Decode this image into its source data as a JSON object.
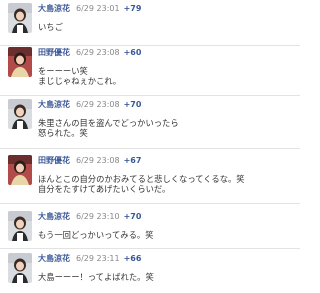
{
  "colors": {
    "name": "#3b5998",
    "time": "#888888",
    "text": "#333333",
    "divider": "#e3e3e3"
  },
  "posts": [
    {
      "author": "大島涼花",
      "time": "6/29 23:01",
      "score": "+79",
      "lines": [
        "いちご"
      ],
      "avatar": "user-a-avatar"
    },
    {
      "author": "田野優花",
      "time": "6/29 23:08",
      "score": "+60",
      "lines": [
        "をーーーい笑",
        "まじじゃねぇかこれ。"
      ],
      "avatar": "user-b-avatar"
    },
    {
      "author": "大島涼花",
      "time": "6/29 23:08",
      "score": "+70",
      "lines": [
        "朱里さんの目を盗んでどっかいったら",
        "怒られた。笑"
      ],
      "avatar": "user-a-avatar"
    },
    {
      "author": "田野優花",
      "time": "6/29 23:08",
      "score": "+67",
      "lines": [
        "ほんとこの自分のかおみてると悲しくなってくるな。笑",
        "自分をたすけてあげたいくらいだ。"
      ],
      "avatar": "user-b-avatar"
    },
    {
      "author": "大島涼花",
      "time": "6/29 23:10",
      "score": "+70",
      "lines": [
        "もう一回どっかいってみる。笑"
      ],
      "avatar": "user-a-avatar"
    },
    {
      "author": "大島涼花",
      "time": "6/29 23:11",
      "score": "+66",
      "lines": [
        "大島ーーー！ってよばれた。笑"
      ],
      "avatar": "user-a-avatar"
    }
  ]
}
